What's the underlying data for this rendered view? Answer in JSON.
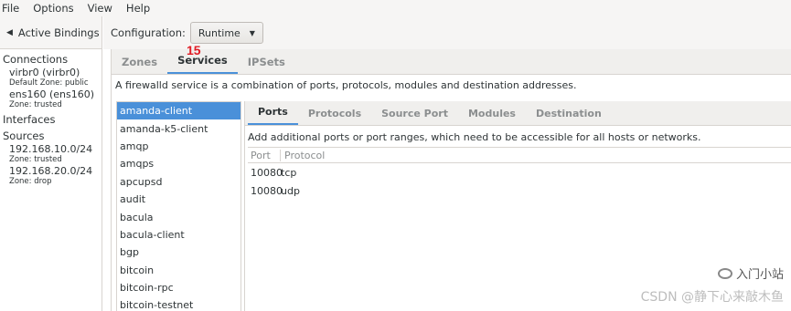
{
  "menubar": [
    "File",
    "Options",
    "View",
    "Help"
  ],
  "left": {
    "active_bindings_label": "Active Bindings",
    "connections_header": "Connections",
    "connections": [
      {
        "name": "virbr0 (virbr0)",
        "zone": "Default Zone: public"
      },
      {
        "name": "ens160 (ens160)",
        "zone": "Zone: trusted"
      }
    ],
    "interfaces_header": "Interfaces",
    "sources_header": "Sources",
    "sources": [
      {
        "name": "192.168.10.0/24",
        "zone": "Zone: trusted"
      },
      {
        "name": "192.168.20.0/24",
        "zone": "Zone: drop"
      }
    ]
  },
  "config": {
    "label": "Configuration:",
    "value": "Runtime"
  },
  "main_tabs": [
    "Zones",
    "Services",
    "IPSets"
  ],
  "annotation": "15",
  "description": "A firewalld service is a combination of ports, protocols, modules and destination addresses.",
  "services": [
    "amanda-client",
    "amanda-k5-client",
    "amqp",
    "amqps",
    "apcupsd",
    "audit",
    "bacula",
    "bacula-client",
    "bgp",
    "bitcoin",
    "bitcoin-rpc",
    "bitcoin-testnet"
  ],
  "sub_tabs": [
    "Ports",
    "Protocols",
    "Source Port",
    "Modules",
    "Destination"
  ],
  "sub_description": "Add additional ports or port ranges, which need to be accessible for all hosts or networks.",
  "ports_table": {
    "headers": [
      "Port",
      "Protocol"
    ],
    "rows": [
      [
        "10080",
        "tcp"
      ],
      [
        "10080",
        "udp"
      ]
    ]
  },
  "watermark": {
    "line1": "入门小站",
    "line2": "CSDN @静下心来敲木鱼"
  },
  "colors": {
    "accent": "#4a90d9",
    "annotation": "#e01b24"
  }
}
